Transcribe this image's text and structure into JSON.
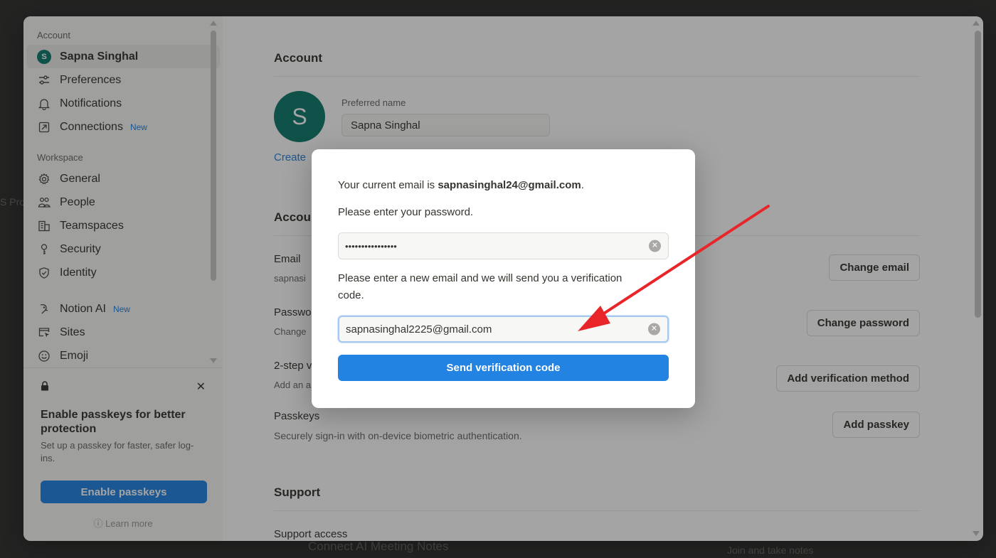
{
  "background": {
    "fragment_left": "S Pro",
    "fragment_bottom": "Connect AI Meeting Notes",
    "fragment_bottom_right": "Join and take notes"
  },
  "sidebar": {
    "account_label": "Account",
    "user_name": "Sapna Singhal",
    "user_initial": "S",
    "account_items": [
      {
        "label": "Preferences",
        "icon": "sliders-icon"
      },
      {
        "label": "Notifications",
        "icon": "bell-icon"
      },
      {
        "label": "Connections",
        "icon": "arrow-box-icon",
        "badge": "New"
      }
    ],
    "workspace_label": "Workspace",
    "workspace_items": [
      {
        "label": "General",
        "icon": "gear-icon"
      },
      {
        "label": "People",
        "icon": "people-icon"
      },
      {
        "label": "Teamspaces",
        "icon": "building-icon"
      },
      {
        "label": "Security",
        "icon": "key-icon"
      },
      {
        "label": "Identity",
        "icon": "shield-check-icon"
      }
    ],
    "other_items": [
      {
        "label": "Notion AI",
        "icon": "ai-face-icon",
        "badge": "New"
      },
      {
        "label": "Sites",
        "icon": "browser-cursor-icon"
      },
      {
        "label": "Emoji",
        "icon": "smiley-icon"
      }
    ]
  },
  "passkey_card": {
    "title": "Enable passkeys for better protection",
    "description": "Set up a passkey for faster, safer log-ins.",
    "button_label": "Enable passkeys",
    "learn_more": "Learn more"
  },
  "main": {
    "account_title": "Account",
    "avatar_initial": "S",
    "preferred_name_label": "Preferred name",
    "preferred_name_value": "Sapna Singhal",
    "create_link": "Create",
    "security_title": "Accou",
    "email_title": "Email",
    "email_desc": "sapnasi",
    "change_email_btn": "Change email",
    "password_title": "Passwo",
    "password_desc": "Change",
    "change_password_btn": "Change password",
    "two_step_title": "2-step v",
    "two_step_desc": "Add an a",
    "add_verification_btn": "Add verification method",
    "passkeys_title": "Passkeys",
    "passkeys_desc": "Securely sign-in with on-device biometric authentication.",
    "add_passkey_btn": "Add passkey",
    "support_title": "Support",
    "support_access": "Support access"
  },
  "modal": {
    "current_email_prefix": "Your current email is ",
    "current_email": "sapnasinghal24@gmail.com",
    "current_email_suffix": ".",
    "password_prompt": "Please enter your password.",
    "password_value": "••••••••••••••••",
    "new_email_prompt": "Please enter a new email and we will send you a verification code.",
    "new_email_value": "sapnasinghal2225@gmail.com",
    "send_button": "Send verification code"
  },
  "colors": {
    "accent": "#2383e2",
    "avatar": "#0f7b6c",
    "annotation_arrow": "#e8262a"
  }
}
